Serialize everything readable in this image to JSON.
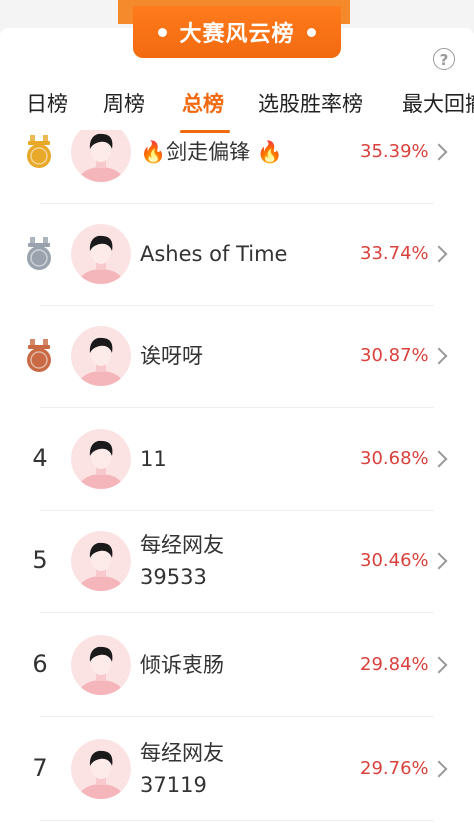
{
  "banner": {
    "title": "大赛风云榜"
  },
  "help": {
    "icon": "question-circle-icon",
    "label": "?"
  },
  "tabs": [
    {
      "label": "日榜",
      "active": false
    },
    {
      "label": "周榜",
      "active": false
    },
    {
      "label": "总榜",
      "active": true
    },
    {
      "label": "选股胜率榜",
      "active": false
    },
    {
      "label": "最大回撤",
      "active": false
    }
  ],
  "rankings": [
    {
      "rank": "1",
      "medal": "gold",
      "name": "🔥剑走偏锋 🔥",
      "name_line2": "",
      "rate": "35.39%"
    },
    {
      "rank": "2",
      "medal": "silver",
      "name": "Ashes of Time",
      "name_line2": "",
      "rate": "33.74%"
    },
    {
      "rank": "3",
      "medal": "bronze",
      "name": "诶呀呀",
      "name_line2": "",
      "rate": "30.87%"
    },
    {
      "rank": "4",
      "medal": "",
      "name": "11",
      "name_line2": "",
      "rate": "30.68%"
    },
    {
      "rank": "5",
      "medal": "",
      "name": "每经网友",
      "name_line2": "39533",
      "rate": "30.46%"
    },
    {
      "rank": "6",
      "medal": "",
      "name": "倾诉衷肠",
      "name_line2": "",
      "rate": "29.84%"
    },
    {
      "rank": "7",
      "medal": "",
      "name": "每经网友",
      "name_line2": "37119",
      "rate": "29.76%"
    }
  ],
  "colors": {
    "accent": "#f26a10",
    "rate": "#d9413c",
    "gold": "#e8a82a",
    "silver": "#9aa3ad",
    "bronze": "#c96a45"
  }
}
